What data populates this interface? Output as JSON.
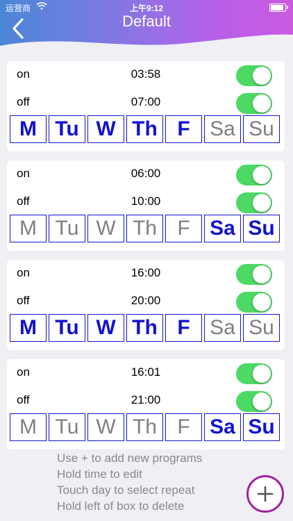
{
  "status_bar": {
    "carrier": "运营商",
    "time": "上午9:12",
    "battery_level": 0.9
  },
  "header": {
    "title": "Default"
  },
  "colors": {
    "toggle_on": "#4cd964",
    "day_active": "#1212d0",
    "day_inactive": "#7f7f7f",
    "add_ring": "#a020a0"
  },
  "programs": [
    {
      "on_label": "on",
      "on_time": "03:58",
      "off_label": "off",
      "off_time": "07:00",
      "on_enabled": true,
      "off_enabled": true,
      "days": [
        {
          "label": "M",
          "active": true
        },
        {
          "label": "Tu",
          "active": true
        },
        {
          "label": "W",
          "active": true
        },
        {
          "label": "Th",
          "active": true
        },
        {
          "label": "F",
          "active": true
        },
        {
          "label": "Sa",
          "active": false
        },
        {
          "label": "Su",
          "active": false
        }
      ]
    },
    {
      "on_label": "on",
      "on_time": "06:00",
      "off_label": "off",
      "off_time": "10:00",
      "on_enabled": true,
      "off_enabled": true,
      "days": [
        {
          "label": "M",
          "active": false
        },
        {
          "label": "Tu",
          "active": false
        },
        {
          "label": "W",
          "active": false
        },
        {
          "label": "Th",
          "active": false
        },
        {
          "label": "F",
          "active": false
        },
        {
          "label": "Sa",
          "active": true
        },
        {
          "label": "Su",
          "active": true
        }
      ]
    },
    {
      "on_label": "on",
      "on_time": "16:00",
      "off_label": "off",
      "off_time": "20:00",
      "on_enabled": true,
      "off_enabled": true,
      "days": [
        {
          "label": "M",
          "active": true
        },
        {
          "label": "Tu",
          "active": true
        },
        {
          "label": "W",
          "active": true
        },
        {
          "label": "Th",
          "active": true
        },
        {
          "label": "F",
          "active": true
        },
        {
          "label": "Sa",
          "active": false
        },
        {
          "label": "Su",
          "active": false
        }
      ]
    },
    {
      "on_label": "on",
      "on_time": "16:01",
      "off_label": "off",
      "off_time": "21:00",
      "on_enabled": true,
      "off_enabled": true,
      "days": [
        {
          "label": "M",
          "active": false
        },
        {
          "label": "Tu",
          "active": false
        },
        {
          "label": "W",
          "active": false
        },
        {
          "label": "Th",
          "active": false
        },
        {
          "label": "F",
          "active": false
        },
        {
          "label": "Sa",
          "active": true
        },
        {
          "label": "Su",
          "active": true
        }
      ]
    }
  ],
  "help": {
    "line1": "Use + to add new programs",
    "line2": "Hold time to edit",
    "line3": "Touch day to select repeat",
    "line4": "Hold left of box to delete"
  },
  "icons": {
    "back": "chevron-left-icon",
    "add": "plus-icon",
    "wifi": "wifi-icon",
    "battery": "battery-icon"
  }
}
